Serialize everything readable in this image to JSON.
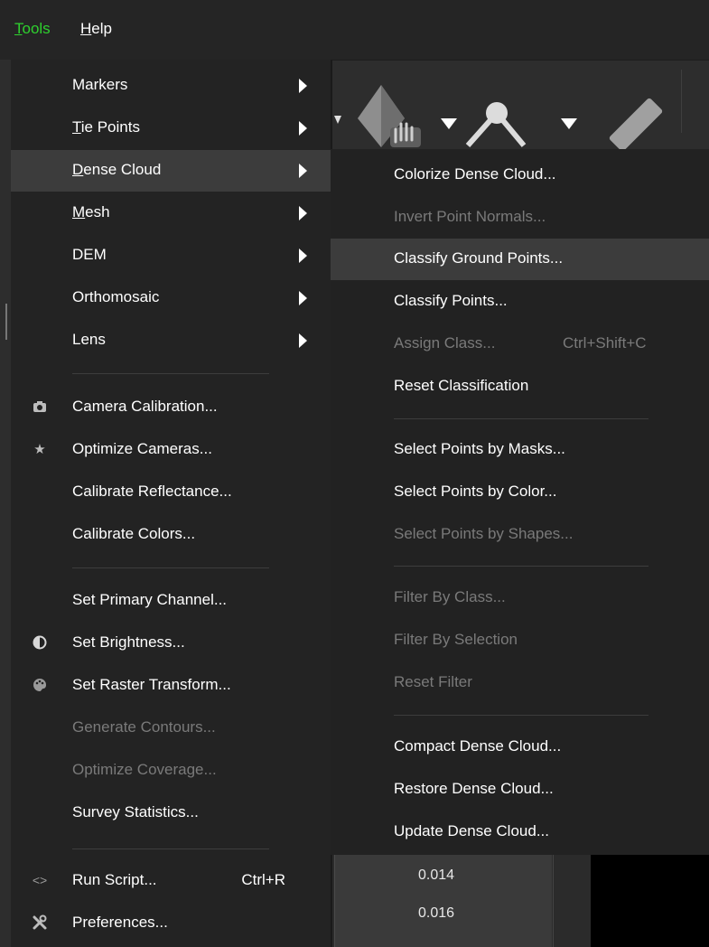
{
  "menubar": {
    "items": [
      {
        "label": "Tools",
        "mnemonic": "T",
        "rest": "ools"
      },
      {
        "label": "Help",
        "mnemonic": "H",
        "rest": "elp"
      }
    ]
  },
  "colors": {
    "active_menu": "#2ed12e",
    "menu_bg": "#232323",
    "highlight_bg": "#3c3c3c",
    "disabled_text": "#7a7a7a"
  },
  "tools_menu": {
    "items": [
      {
        "label": "Markers",
        "submenu": true
      },
      {
        "label": "Tie Points",
        "mnemonic": "T",
        "rest": "ie Points",
        "submenu": true
      },
      {
        "label": "Dense Cloud",
        "mnemonic": "D",
        "rest": "ense Cloud",
        "submenu": true,
        "highlighted": true
      },
      {
        "label": "Mesh",
        "mnemonic": "M",
        "rest": "esh",
        "submenu": true
      },
      {
        "label": "DEM",
        "submenu": true
      },
      {
        "label": "Orthomosaic",
        "submenu": true
      },
      {
        "label": "Lens",
        "submenu": true
      },
      {
        "label": "Camera Calibration...",
        "icon": "camera-icon"
      },
      {
        "label": "Optimize Cameras...",
        "icon": "star-icon"
      },
      {
        "label": "Calibrate Reflectance..."
      },
      {
        "label": "Calibrate Colors..."
      },
      {
        "label": "Set Primary Channel..."
      },
      {
        "label": "Set Brightness...",
        "icon": "brightness-icon"
      },
      {
        "label": "Set Raster Transform...",
        "icon": "palette-icon"
      },
      {
        "label": "Generate Contours...",
        "disabled": true
      },
      {
        "label": "Optimize Coverage...",
        "disabled": true
      },
      {
        "label": "Survey Statistics..."
      },
      {
        "label": "Run Script...",
        "icon": "code-icon",
        "shortcut": "Ctrl+R"
      },
      {
        "label": "Preferences...",
        "icon": "tools-icon"
      }
    ]
  },
  "dense_cloud_submenu": {
    "items": [
      {
        "label": "Colorize Dense Cloud..."
      },
      {
        "label": "Invert Point Normals...",
        "disabled": true
      },
      {
        "label": "Classify Ground Points...",
        "highlighted": true
      },
      {
        "label": "Classify Points..."
      },
      {
        "label": "Assign Class...",
        "disabled": true,
        "shortcut": "Ctrl+Shift+C"
      },
      {
        "label": "Reset Classification"
      },
      {
        "label": "Select Points by Masks..."
      },
      {
        "label": "Select Points by Color..."
      },
      {
        "label": "Select Points by Shapes...",
        "disabled": true
      },
      {
        "label": "Filter By Class...",
        "disabled": true
      },
      {
        "label": "Filter By Selection",
        "disabled": true
      },
      {
        "label": "Reset Filter",
        "disabled": true
      },
      {
        "label": "Compact Dense Cloud..."
      },
      {
        "label": "Restore Dense Cloud..."
      },
      {
        "label": "Update Dense Cloud..."
      }
    ]
  },
  "value_panel": {
    "values": [
      "0.014",
      "0.016"
    ]
  }
}
